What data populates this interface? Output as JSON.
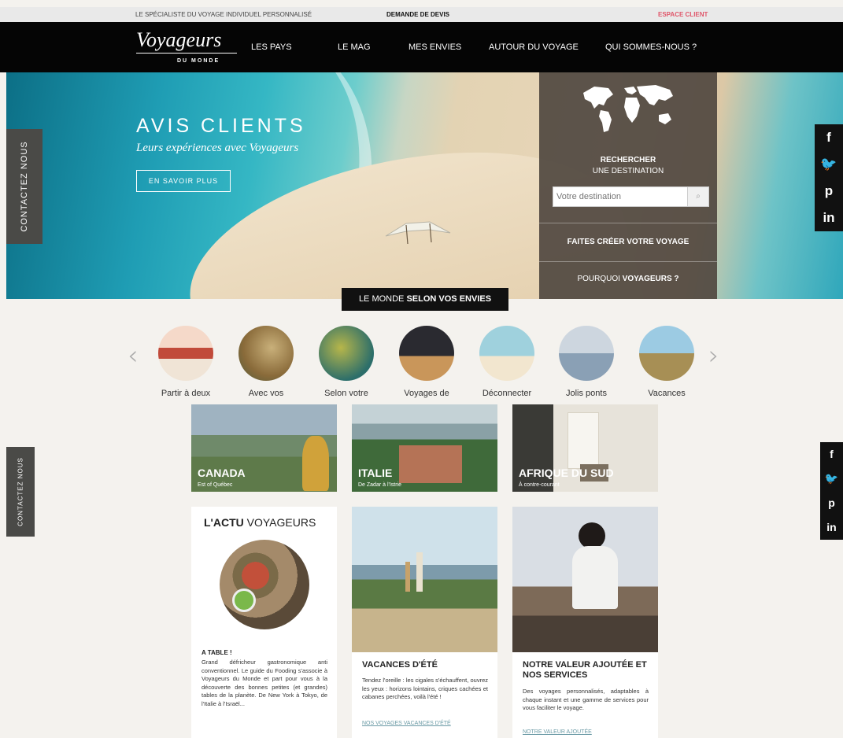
{
  "topbar": {
    "tagline": "LE SPÉCIALISTE DU VOYAGE INDIVIDUEL PERSONNALISÉ",
    "devis": "DEMANDE DE DEVIS",
    "espace_client": "ESPACE CLIENT"
  },
  "logo": {
    "main": "Voyageurs",
    "sub": "DU MONDE"
  },
  "nav": [
    "LES PAYS",
    "LE MAG",
    "MES ENVIES",
    "AUTOUR DU VOYAGE",
    "QUI SOMMES-NOUS ?"
  ],
  "hero": {
    "title": "AVIS CLIENTS",
    "subtitle": "Leurs expériences avec Voyageurs",
    "button": "EN SAVOIR PLUS",
    "contact_tab": "CONTACTEZ NOUS"
  },
  "search_panel": {
    "title": "RECHERCHER",
    "subtitle": "UNE DESTINATION",
    "placeholder": "Votre destination",
    "create": "FAITES CRÉER VOTRE VOYAGE",
    "why_prefix": "POURQUOI ",
    "why_bold": "VOYAGEURS ?"
  },
  "social": [
    "f",
    "🐦",
    "p",
    "in"
  ],
  "monde": {
    "prefix": "LE MONDE ",
    "bold": "SELON VOS ENVIES"
  },
  "carousel": {
    "prev": "‹",
    "next": "›",
    "items": [
      {
        "label": "Partir à deux",
        "colors": [
          "#f5d9c9",
          "#c14a3a"
        ]
      },
      {
        "label": "Avec vos",
        "colors": [
          "#8a6b3a",
          "#c9b07a"
        ]
      },
      {
        "label": "Selon votre",
        "colors": [
          "#2c6e6a",
          "#b7b64a"
        ]
      },
      {
        "label": "Voyages de",
        "colors": [
          "#2a2a30",
          "#c9965a"
        ]
      },
      {
        "label": "Déconnecter",
        "colors": [
          "#9fd1dd",
          "#f2e6cf"
        ]
      },
      {
        "label": "Jolis ponts",
        "colors": [
          "#cdd6df",
          "#8aa0b5"
        ]
      },
      {
        "label": "Vacances",
        "colors": [
          "#9ccbe3",
          "#a78f55"
        ]
      }
    ]
  },
  "tiles": [
    {
      "name": "CANADA",
      "sub": "Est of Québec",
      "colors": [
        "#5e7a4a",
        "#9fb3c1",
        "#d0a23a"
      ]
    },
    {
      "name": "ITALIE",
      "sub": "De Zadar à l'Istrie",
      "colors": [
        "#8aa1a6",
        "#3f6a3a",
        "#b57356"
      ]
    },
    {
      "name": "AFRIQUE DU SUD",
      "sub": "À contre-courant",
      "colors": [
        "#d9d4c8",
        "#f3f0ea",
        "#7b6f5f"
      ]
    }
  ],
  "actu": {
    "title_bold": "L'ACTU",
    "title_rest": " VOYAGEURS",
    "heading": "A TABLE !",
    "text": "Grand défricheur gastronomique anti conventionnel. Le guide du Fooding s'associe à Voyageurs du Monde et part pour vous à la découverte des bonnes petites (et grandes) tables de la planète. De New York à Tokyo, de l'Italie à l'Israël..."
  },
  "ete": {
    "title": "VACANCES D'ÉTÉ",
    "text": "Tendez l'oreille : les cigales s'échauffent, ouvrez les yeux : horizons lointains, criques cachées et cabanes perchées, voilà l'été !",
    "link": "NOS VOYAGES VACANCES D'ÉTÉ"
  },
  "valeur": {
    "title": "NOTRE VALEUR AJOUTÉE ET NOS SERVICES",
    "text": "Des voyages personnalisés, adaptables à chaque instant et une gamme de services pour vous faciliter le voyage.",
    "link": "NOTRE VALEUR AJOUTÉE"
  },
  "colors": {
    "accent": "#e0566a",
    "link": "#6a9aa5",
    "panel": "#504840"
  }
}
